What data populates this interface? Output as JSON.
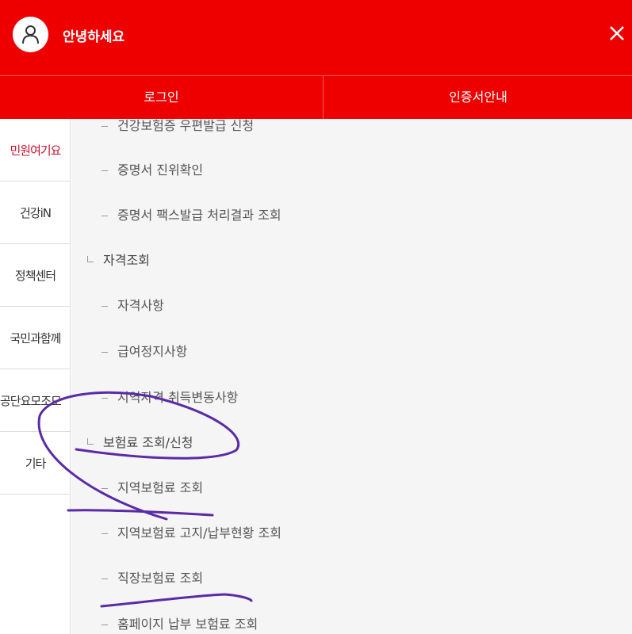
{
  "header": {
    "greeting": "안녕하세요",
    "accent_color": "#ee0000",
    "avatar_icon": "user-icon",
    "close_icon": "close-icon"
  },
  "auth_bar": {
    "login_label": "로그인",
    "certificate_label": "인증서안내"
  },
  "side_nav": {
    "items": [
      {
        "label": "민원여기요",
        "active": true
      },
      {
        "label": "건강iN"
      },
      {
        "label": "정책센터"
      },
      {
        "label": "국민과함께"
      },
      {
        "label": "공단요모조모"
      },
      {
        "label": "기타"
      }
    ]
  },
  "menu": {
    "items": [
      {
        "label": "건강보험증 우편발급 신청",
        "level": "sub"
      },
      {
        "label": "증명서 진위확인",
        "level": "sub"
      },
      {
        "label": "증명서 팩스발급 처리결과 조회",
        "level": "sub"
      },
      {
        "label": "자격조회",
        "level": "group"
      },
      {
        "label": "자격사항",
        "level": "sub"
      },
      {
        "label": "급여정지사항",
        "level": "sub"
      },
      {
        "label": "지역자격 취득변동사항",
        "level": "sub"
      },
      {
        "label": "보험료 조회/신청",
        "level": "group"
      },
      {
        "label": "지역보험료 조회",
        "level": "sub"
      },
      {
        "label": "지역보험료 고지/납부현황 조회",
        "level": "sub"
      },
      {
        "label": "직장보험료 조회",
        "level": "sub"
      },
      {
        "label": "홈페이지 납부 보험료 조회",
        "level": "sub"
      }
    ]
  },
  "annotation": {
    "color": "#5b2aa8"
  }
}
